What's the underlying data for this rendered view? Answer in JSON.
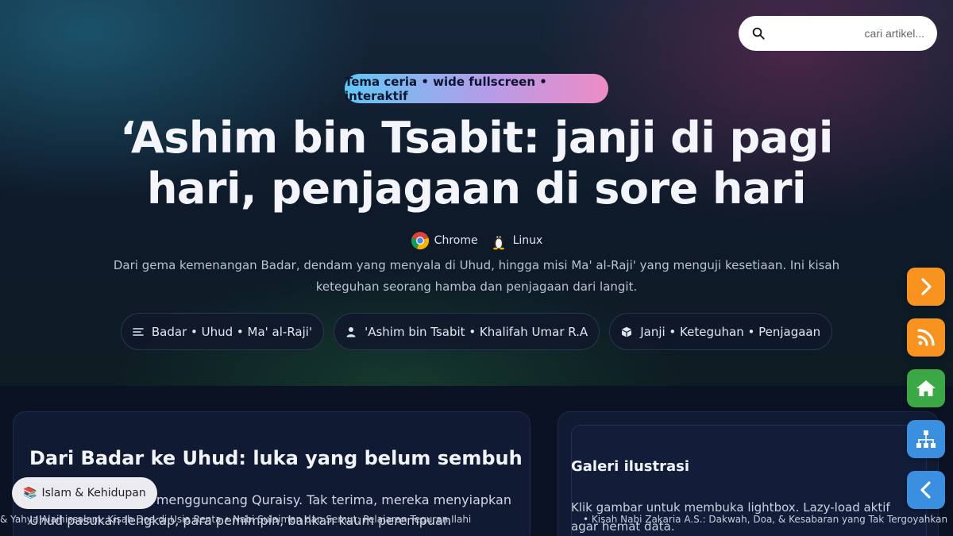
{
  "search": {
    "placeholder": "cari artikel..."
  },
  "hero": {
    "pill": "Tema ceria • wide fullscreen • interaktif",
    "title": "‘Ashim bin Tsabit: janji di pagi hari, penjagaan di sore hari",
    "browsers": [
      {
        "label": "Chrome",
        "icon": "chrome-icon"
      },
      {
        "label": "Linux",
        "icon": "linux-tux-icon"
      }
    ],
    "lead": "Dari gema kemenangan Badar, dendam yang menyala di Uhud, hingga misi Ma' al-Raji' yang menguji kesetiaan. Ini kisah keteguhan seorang hamba dan penjagaan dari langit.",
    "chips": [
      {
        "label": "Badar • Uhud • Ma' al-Raji'",
        "icon": "list-icon"
      },
      {
        "label": "'Ashim bin Tsabit • Khalifah Umar R.A",
        "icon": "user-icon"
      },
      {
        "label": "Janji • Keteguhan • Penjagaan",
        "icon": "cube-icon"
      }
    ]
  },
  "article": {
    "heading": "Dari Badar ke Uhud: luka yang belum sembuh",
    "text": "Kekalahan di Badar mengguncang Quraisy. Tak terima, mereka menyiapkan Uhud pasukan lengkap, para pemimpin, bahkan kaum perempuan"
  },
  "gallery": {
    "heading": "Galeri ilustrasi",
    "text": "Klik gambar untuk membuka lightbox. Lazy-load aktif agar hemat data."
  },
  "category": {
    "label": "Islam & Kehidupan",
    "icon": "books-icon"
  },
  "ticker": {
    "left": "& Yahya Alaihissalam: Kisah Doa di Usia Renta • Nabi Sulaiman dan Semut: Pelajaran Teguran Ilahi",
    "right": "• Kisah Nabi Zakaria A.S.: Dakwah, Doa, & Kesabaran yang Tak Tergoyahkan"
  },
  "fabs": [
    {
      "name": "next-button",
      "icon": "chevron-right-icon",
      "color": "#f7931e"
    },
    {
      "name": "rss-button",
      "icon": "rss-icon",
      "color": "#f7931e"
    },
    {
      "name": "home-button",
      "icon": "home-icon",
      "color": "#3aa845"
    },
    {
      "name": "sitemap-button",
      "icon": "sitemap-icon",
      "color": "#3b8fe0"
    },
    {
      "name": "prev-button",
      "icon": "chevron-left-icon",
      "color": "#3b8fe0"
    }
  ]
}
